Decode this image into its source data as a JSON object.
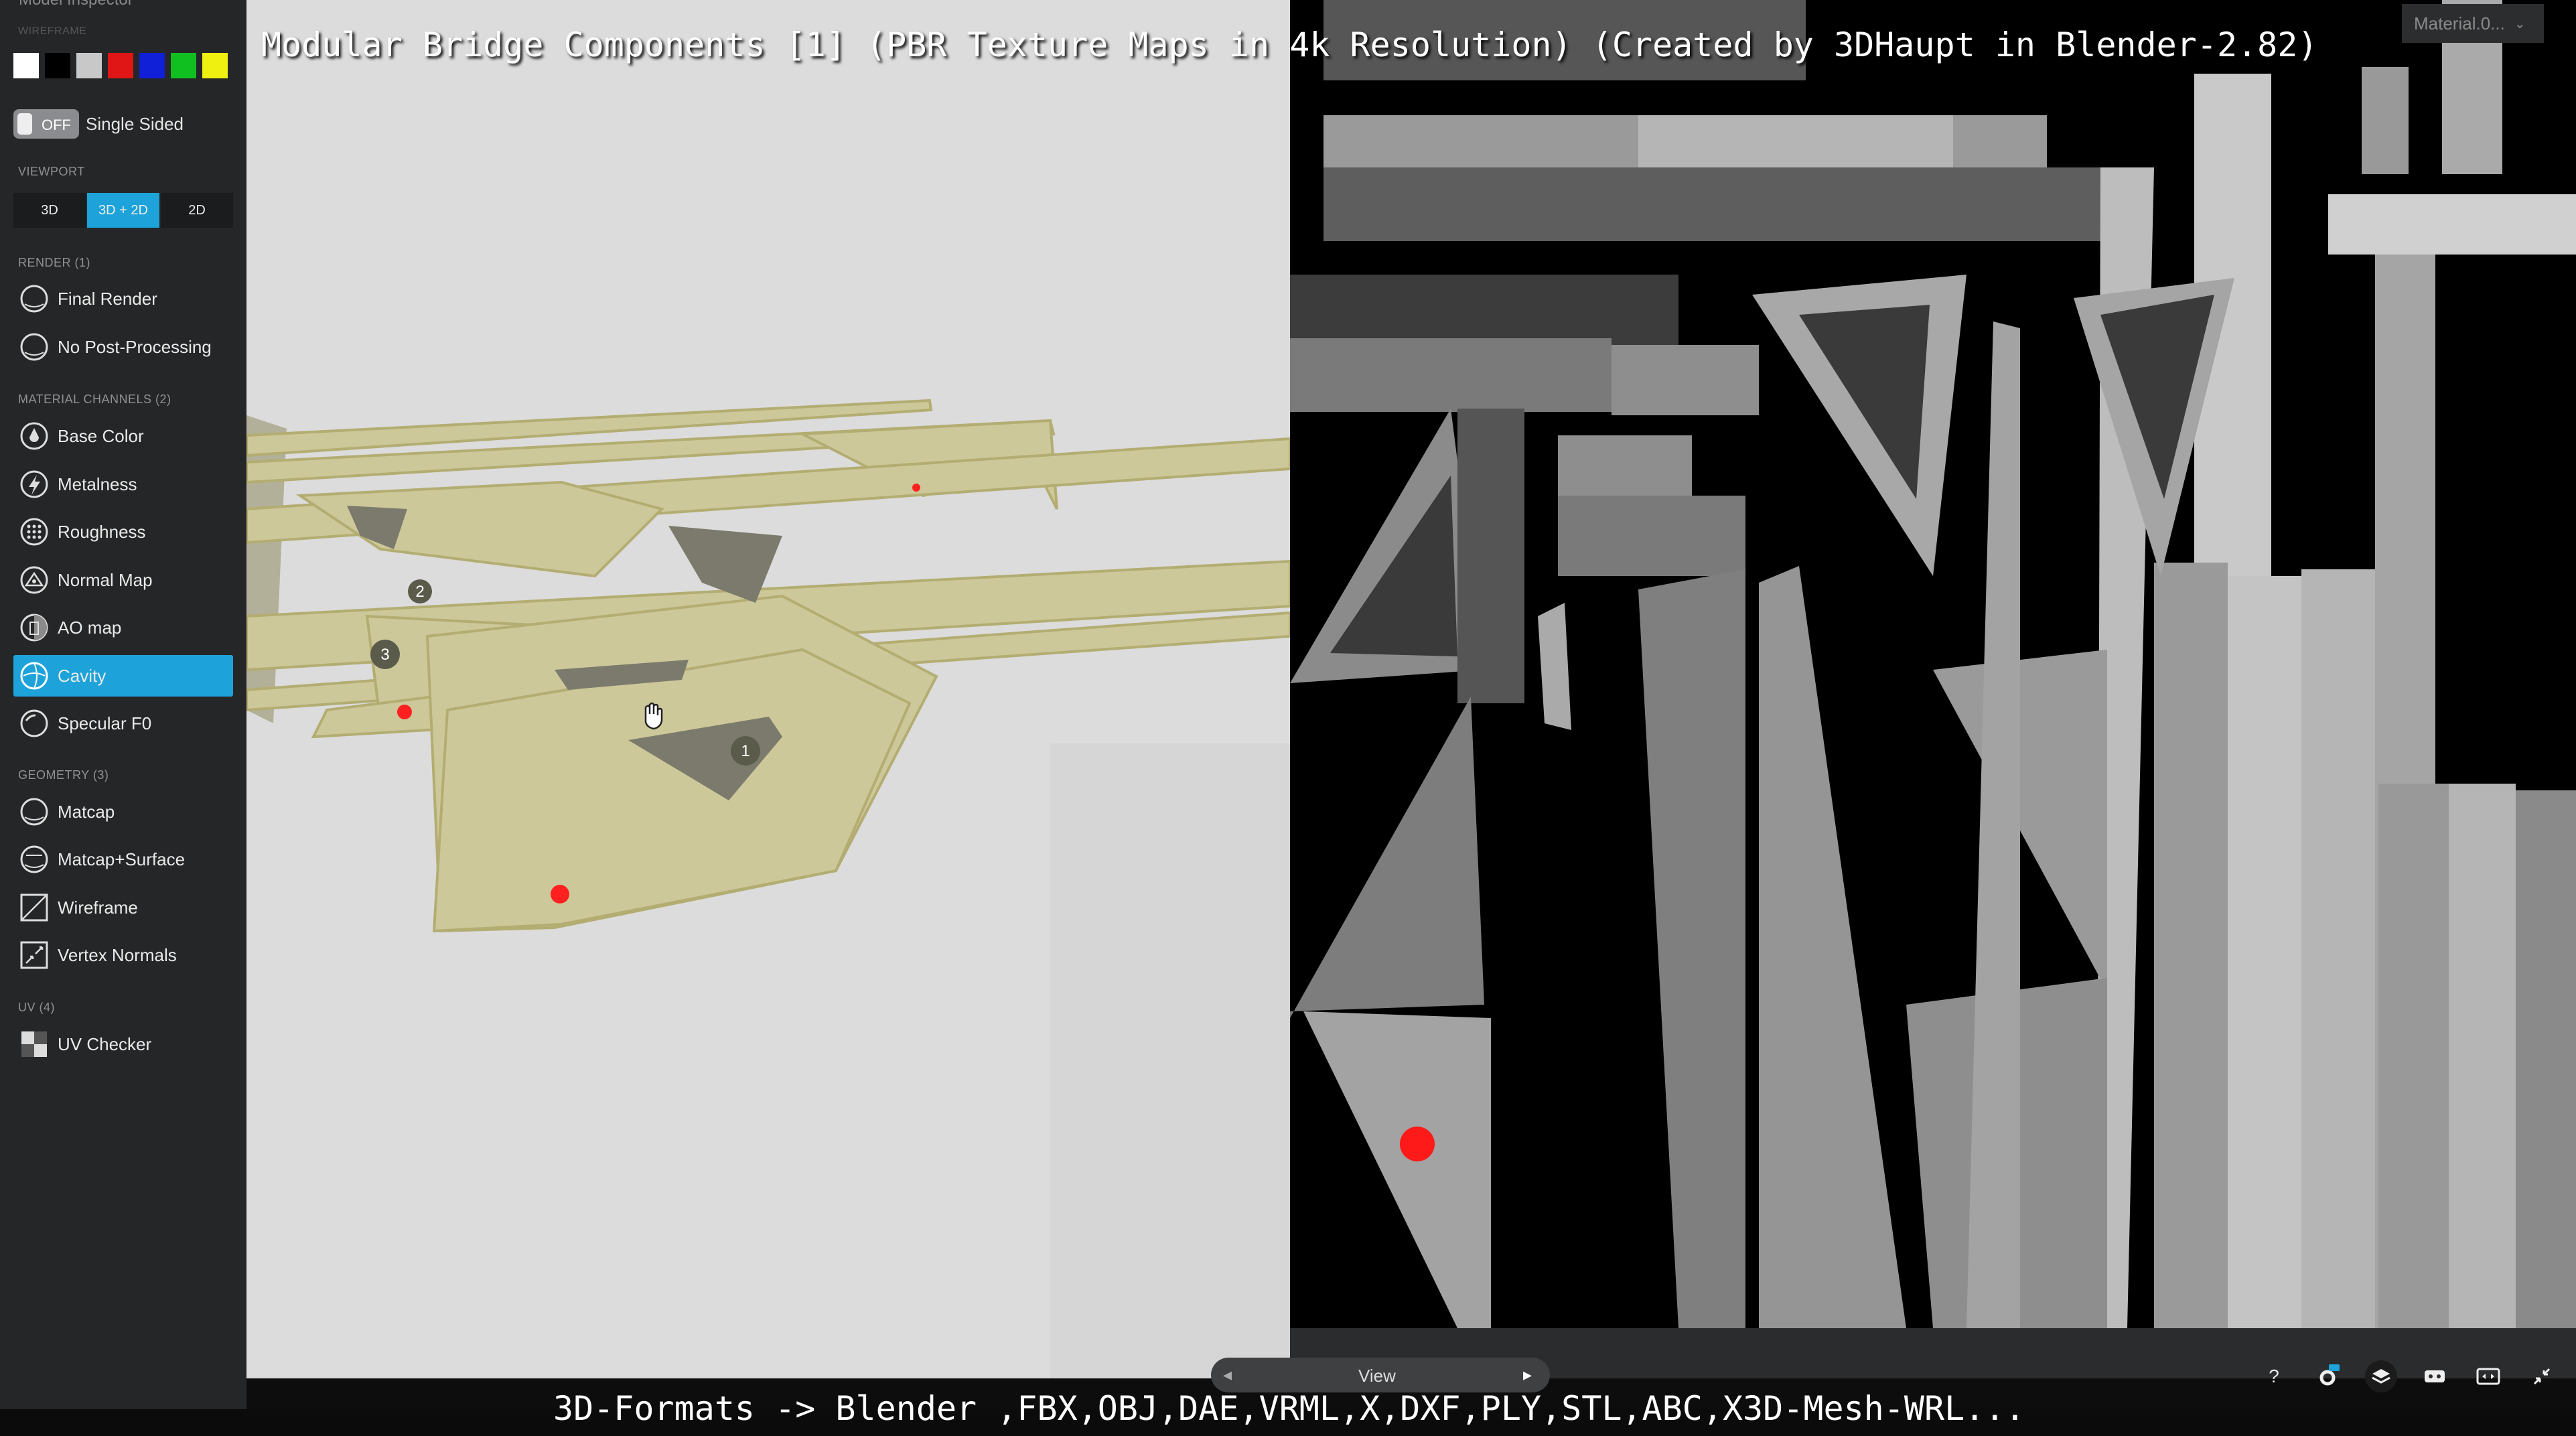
{
  "title_overlay": "Modular Bridge Components [1] (PBR Texture Maps in 4k Resolution) (Created by 3DHaupt in Blender-2.82)",
  "bottom_overlay": "3D-Formats -> Blender ,FBX,OBJ,DAE,VRML,X,DXF,PLY,STL,ABC,X3D-Mesh-WRL...",
  "sidebar": {
    "header": "Model Inspector",
    "wireframe_label": "WIREFRAME",
    "wireframe_colors": [
      "#ffffff",
      "#000000",
      "#c8c8c8",
      "#e01515",
      "#1020d8",
      "#10c020",
      "#f0f010"
    ],
    "single_sided": {
      "state": "OFF",
      "label": "Single Sided"
    },
    "viewport_label": "VIEWPORT",
    "viewport_buttons": [
      "3D",
      "3D + 2D",
      "2D"
    ],
    "render_label": "RENDER (1)",
    "render_items": [
      "Final Render",
      "No Post-Processing"
    ],
    "material_label": "MATERIAL CHANNELS (2)",
    "material_items": [
      "Base Color",
      "Metalness",
      "Roughness",
      "Normal Map",
      "AO map",
      "Cavity",
      "Specular F0"
    ],
    "geometry_label": "GEOMETRY (3)",
    "geometry_items": [
      "Matcap",
      "Matcap+Surface",
      "Wireframe",
      "Vertex Normals"
    ],
    "uv_label": "UV (4)",
    "uv_items": [
      "UV Checker"
    ]
  },
  "annotations": [
    "1",
    "2",
    "3"
  ],
  "uv_panel": {
    "material_select": "Material.0...",
    "view_label": "View"
  },
  "colors": {
    "accent": "#1da3d9",
    "model": "#cdc89a",
    "hotspot": "#ff1a1a"
  }
}
